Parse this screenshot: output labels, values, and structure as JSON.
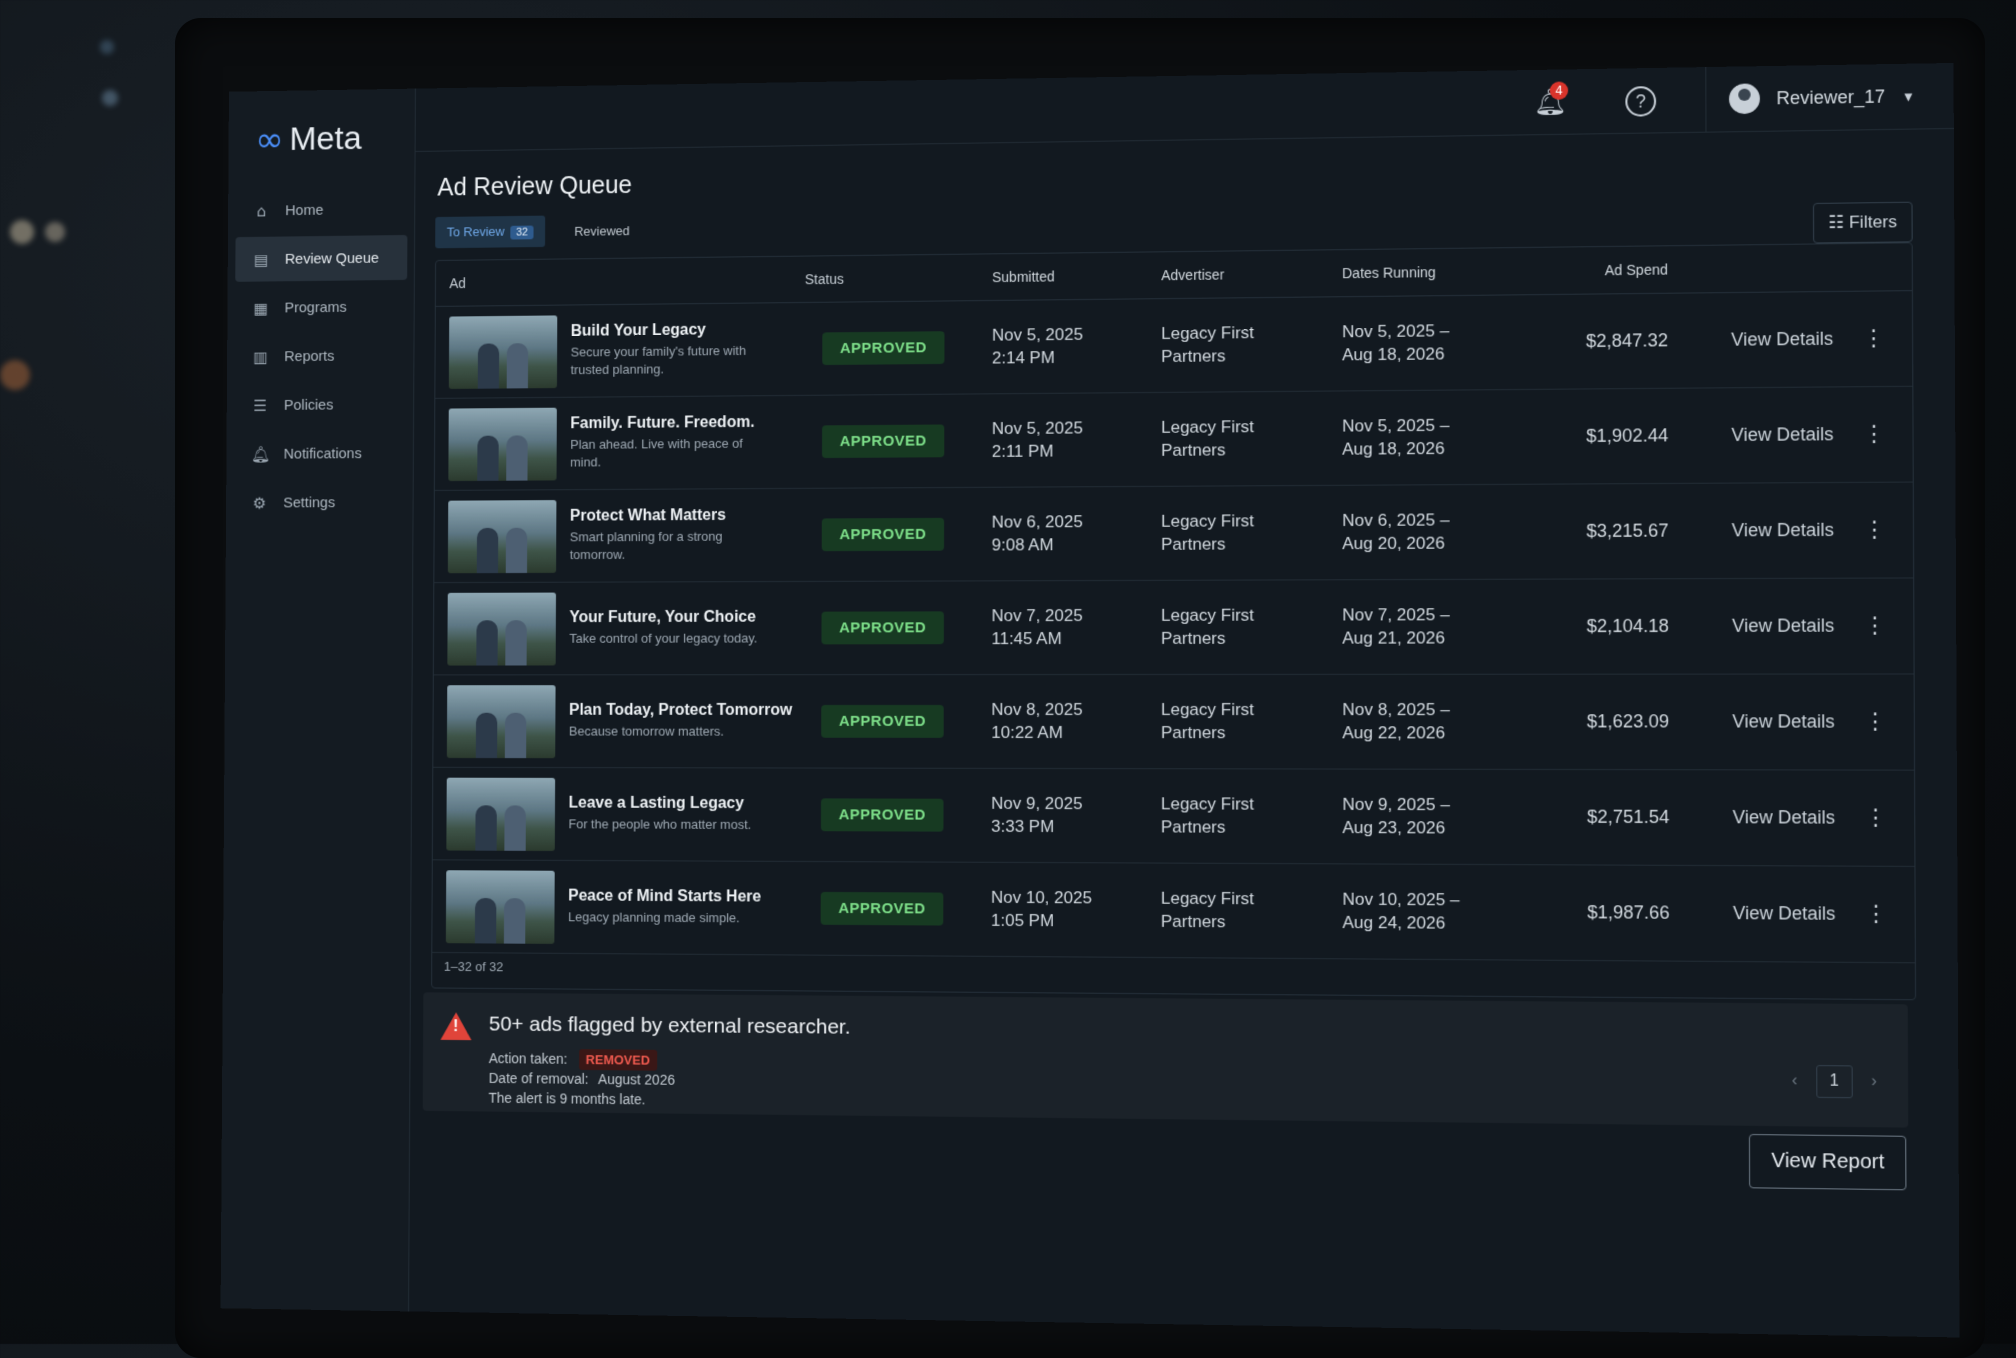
{
  "brand": {
    "name": "Meta"
  },
  "sidebar": {
    "items": [
      {
        "label": "Home",
        "icon": "home-icon"
      },
      {
        "label": "Review Queue",
        "icon": "document-icon",
        "active": true
      },
      {
        "label": "Programs",
        "icon": "programs-icon"
      },
      {
        "label": "Reports",
        "icon": "chart-icon"
      },
      {
        "label": "Policies",
        "icon": "policy-icon"
      },
      {
        "label": "Notifications",
        "icon": "bell-icon"
      },
      {
        "label": "Settings",
        "icon": "gear-icon"
      }
    ]
  },
  "header": {
    "notification_count": "4",
    "user": "Reviewer_17"
  },
  "main": {
    "title": "Ad Review Queue",
    "tabs": [
      {
        "label": "To Review",
        "count": "32",
        "active": true
      },
      {
        "label": "Reviewed"
      }
    ],
    "filters_label": "Filters",
    "columns": [
      "Ad",
      "Status",
      "Submitted",
      "Advertiser",
      "Dates Running",
      "Ad Spend"
    ],
    "rows": [
      {
        "title": "Build Your Legacy",
        "desc": "Secure your family's future with trusted planning.",
        "status": "APPROVED",
        "submitted_date": "Nov 5, 2025",
        "submitted_time": "2:14 PM",
        "advertiser_1": "Legacy First",
        "advertiser_2": "Partners",
        "dates_1": "Nov 5, 2025 –",
        "dates_2": "Aug 18, 2026",
        "spend": "$2,847.32",
        "action": "View Details"
      },
      {
        "title": "Family. Future. Freedom.",
        "desc": "Plan ahead. Live with peace of mind.",
        "status": "APPROVED",
        "submitted_date": "Nov 5, 2025",
        "submitted_time": "2:11 PM",
        "advertiser_1": "Legacy First",
        "advertiser_2": "Partners",
        "dates_1": "Nov 5, 2025 –",
        "dates_2": "Aug 18, 2026",
        "spend": "$1,902.44",
        "action": "View Details"
      },
      {
        "title": "Protect What Matters",
        "desc": "Smart planning for a strong tomorrow.",
        "status": "APPROVED",
        "submitted_date": "Nov 6, 2025",
        "submitted_time": "9:08 AM",
        "advertiser_1": "Legacy First",
        "advertiser_2": "Partners",
        "dates_1": "Nov 6, 2025 –",
        "dates_2": "Aug 20, 2026",
        "spend": "$3,215.67",
        "action": "View Details"
      },
      {
        "title": "Your Future, Your Choice",
        "desc": "Take control of your legacy today.",
        "status": "APPROVED",
        "submitted_date": "Nov 7, 2025",
        "submitted_time": "11:45 AM",
        "advertiser_1": "Legacy First",
        "advertiser_2": "Partners",
        "dates_1": "Nov 7, 2025 –",
        "dates_2": "Aug 21, 2026",
        "spend": "$2,104.18",
        "action": "View Details"
      },
      {
        "title": "Plan Today, Protect Tomorrow",
        "desc": "Because tomorrow matters.",
        "status": "APPROVED",
        "submitted_date": "Nov 8, 2025",
        "submitted_time": "10:22 AM",
        "advertiser_1": "Legacy First",
        "advertiser_2": "Partners",
        "dates_1": "Nov 8, 2025 –",
        "dates_2": "Aug 22, 2026",
        "spend": "$1,623.09",
        "action": "View Details"
      },
      {
        "title": "Leave a Lasting Legacy",
        "desc": "For the people who matter most.",
        "status": "APPROVED",
        "submitted_date": "Nov 9, 2025",
        "submitted_time": "3:33 PM",
        "advertiser_1": "Legacy First",
        "advertiser_2": "Partners",
        "dates_1": "Nov 9, 2025 –",
        "dates_2": "Aug 23, 2026",
        "spend": "$2,751.54",
        "action": "View Details"
      },
      {
        "title": "Peace of Mind Starts Here",
        "desc": "Legacy planning made simple.",
        "status": "APPROVED",
        "submitted_date": "Nov 10, 2025",
        "submitted_time": "1:05 PM",
        "advertiser_1": "Legacy First",
        "advertiser_2": "Partners",
        "dates_1": "Nov 10, 2025 –",
        "dates_2": "Aug 24, 2026",
        "spend": "$1,987.66",
        "action": "View Details"
      }
    ],
    "range_text": "1–32 of 32"
  },
  "alert": {
    "title": "50+ ads flagged by external researcher.",
    "action_label": "Action taken:",
    "action_value": "REMOVED",
    "date_label": "Date of removal:",
    "date_value": "August 2026",
    "note": "The alert is 9 months late.",
    "page": "1"
  },
  "view_report_label": "View Report",
  "colors": {
    "approved": "#7ee08a",
    "removed": "#ef5a4f",
    "brand": "#4a8df6"
  }
}
